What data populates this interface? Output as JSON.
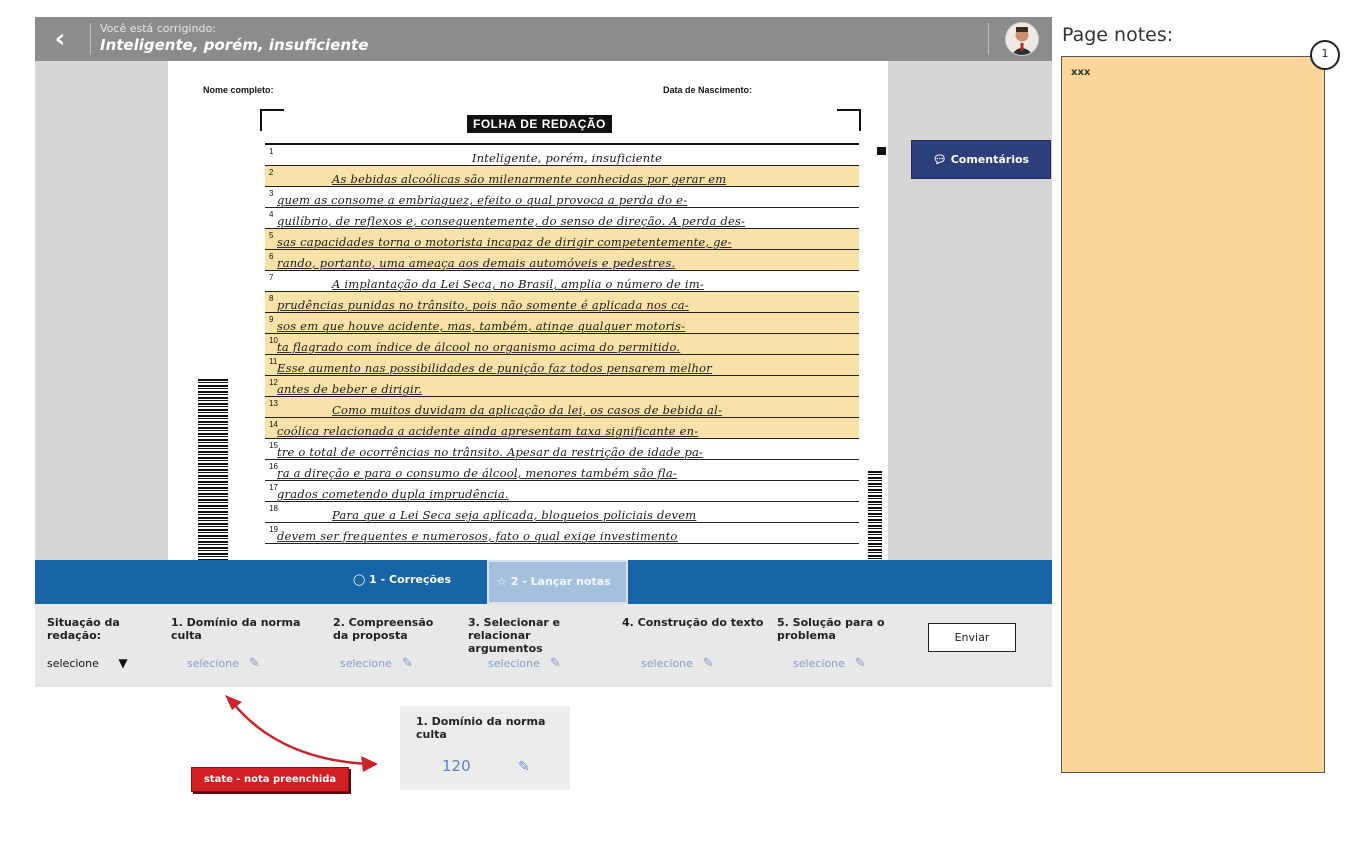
{
  "topbar": {
    "subtitle": "Você está corrigindo:",
    "title": "Inteligente, porém, insuficiente"
  },
  "sheet": {
    "name_label": "Nome completo:",
    "birth_label": "Data de Nascimento:",
    "title": "FOLHA DE REDAÇÃO",
    "lines": [
      {
        "n": "1",
        "text": "Inteligente, porém, insuficiente"
      },
      {
        "n": "2",
        "text": "As bebidas alcoólicas são milenarmente conhecidas por gerar em"
      },
      {
        "n": "3",
        "text": "quem as consome a embriaguez, efeito o qual provoca a perda do e-"
      },
      {
        "n": "4",
        "text": "quilíbrio, de reflexos e, consequentemente, do senso de direção. A perda des-"
      },
      {
        "n": "5",
        "text": "sas capacidades torna o motorista incapaz de dirigir competentemente, ge-"
      },
      {
        "n": "6",
        "text": "rando, portanto, uma ameaça aos demais automóveis e pedestres."
      },
      {
        "n": "7",
        "text": "A implantação da Lei Seca, no Brasil, amplia o número de im-"
      },
      {
        "n": "8",
        "text": "prudências punidas no trânsito, pois não somente é aplicada nos ca-"
      },
      {
        "n": "9",
        "text": "sos em que houve acidente, mas, também, atinge qualquer motoris-"
      },
      {
        "n": "10",
        "text": "ta flagrado com índice de álcool no organismo acima do permitido."
      },
      {
        "n": "11",
        "text": "Esse aumento nas possibilidades de punição faz todos pensarem melhor"
      },
      {
        "n": "12",
        "text": "antes de beber e dirigir."
      },
      {
        "n": "13",
        "text": "Como muitos duvidam da aplicação da lei, os casos de bebida al-"
      },
      {
        "n": "14",
        "text": "coólica relacionada a acidente ainda apresentam taxa significante en-"
      },
      {
        "n": "15",
        "text": "tre o total de ocorrências no trânsito. Apesar da restrição de idade pa-"
      },
      {
        "n": "16",
        "text": "ra a direção e para o consumo de álcool, menores também são fla-"
      },
      {
        "n": "17",
        "text": "grados cometendo dupla imprudência."
      },
      {
        "n": "18",
        "text": "Para que a Lei Seca seja aplicada, bloqueios policiais devem"
      },
      {
        "n": "19",
        "text": "devem ser frequentes e numerosos, fato o qual exige investimento"
      }
    ]
  },
  "comments_button": "Comentários",
  "tabs": [
    {
      "label": "1 - Correções"
    },
    {
      "label": "2 - Lançar notas"
    }
  ],
  "grades": {
    "status_label": "Situação da redação:",
    "status_value": "selecione",
    "competencies": [
      {
        "title": "1. Domínio da norma culta",
        "value": "selecione"
      },
      {
        "title": "2. Compreensão da proposta",
        "value": "selecione"
      },
      {
        "title": "3. Selecionar e relacionar argumentos",
        "value": "selecione"
      },
      {
        "title": "4. Construção do texto",
        "value": "selecione"
      },
      {
        "title": "5. Solução para o problema",
        "value": "selecione"
      }
    ],
    "send_label": "Enviar"
  },
  "state_card": {
    "title": "1. Domínio da norma culta",
    "value": "120"
  },
  "state_label": "state - nota preenchida",
  "notes": {
    "title": "Page notes:",
    "text": "xxx",
    "badge": "1"
  },
  "colors": {
    "topbar": "#8c8c8c",
    "tabbar": "#1764a7",
    "comments": "#2d3f7a",
    "highlight": "#f9e2a7",
    "notes": "#fbd79a",
    "state_label": "#d21f24"
  }
}
